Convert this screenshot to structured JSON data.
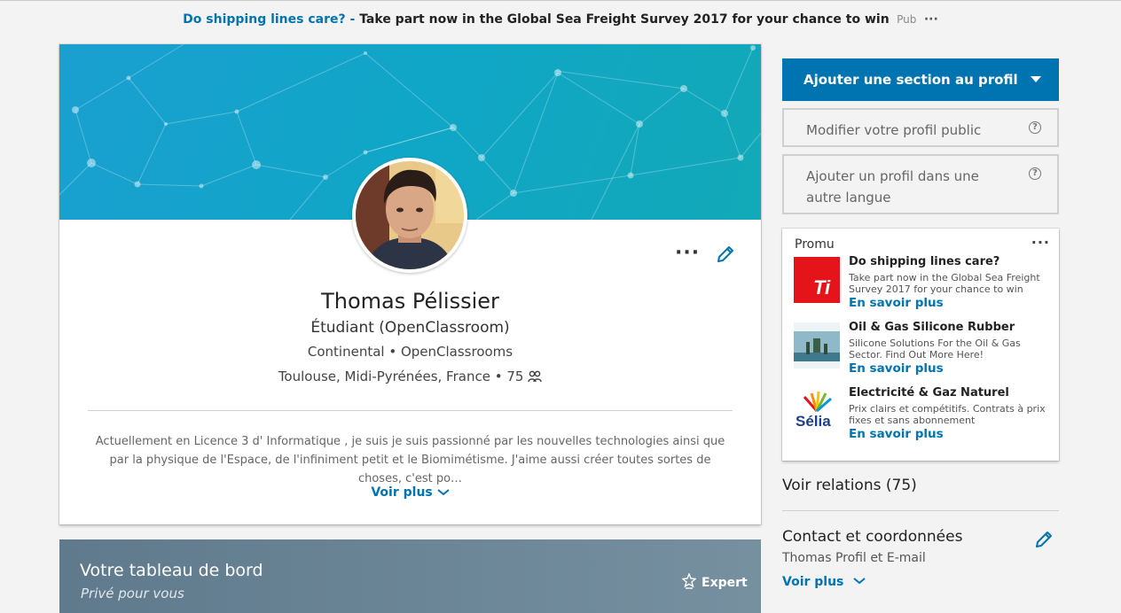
{
  "top_ad": {
    "link": "Do shipping lines care?",
    "separator": " - ",
    "message": "Take part now in the Global Sea Freight Survey 2017 for your chance to win",
    "tag": "Pub",
    "more": "···"
  },
  "profile": {
    "name": "Thomas Pélissier",
    "headline": "Étudiant (OpenClassroom)",
    "company_line": "Continental • OpenClassrooms",
    "location": "Toulouse, Midi-Pyrénées, France • 75",
    "summary": "Actuellement en Licence 3 d' Informatique , je suis je suis passionné par les nouvelles technologies ainsi que par la physique de l'Espace, de l'infiniment petit et le Biomimétisme. J'aime aussi créer toutes sortes de choses, c'est po…",
    "see_more": "Voir plus",
    "more_actions": "···"
  },
  "dashboard": {
    "title": "Votre tableau de bord",
    "subtitle": "Privé pour vous",
    "badge": "Expert"
  },
  "sidebar": {
    "add_section": "Ajouter une section au profil",
    "edit_public": "Modifier votre profil public",
    "add_language": "Ajouter un profil dans une autre langue",
    "help_glyph": "?",
    "promo": {
      "label": "Promu",
      "more": "···",
      "items": [
        {
          "title": "Do shipping lines care?",
          "desc": "Take part now in the Global Sea Freight Survey 2017 for your chance to win",
          "cta": "En savoir plus",
          "logo_text": "Ti"
        },
        {
          "title": "Oil & Gas Silicone Rubber",
          "desc": "Silicone Solutions For the Oil & Gas Sector. Find Out More Here!",
          "cta": "En savoir plus"
        },
        {
          "title": "Electricité & Gaz Naturel",
          "desc": "Prix clairs et compétitifs. Contrats à prix fixes et sans abonnement",
          "cta": "En savoir plus",
          "logo_text": "Sélia"
        }
      ]
    },
    "relations": "Voir relations (75)",
    "contact": {
      "title": "Contact et coordonnées",
      "subtitle": "Thomas Profil et E-mail",
      "see_more": "Voir plus"
    }
  },
  "colors": {
    "link_blue": "#0073b1",
    "banner_teal": "#12a5c4",
    "promo_red": "#e5141b"
  }
}
